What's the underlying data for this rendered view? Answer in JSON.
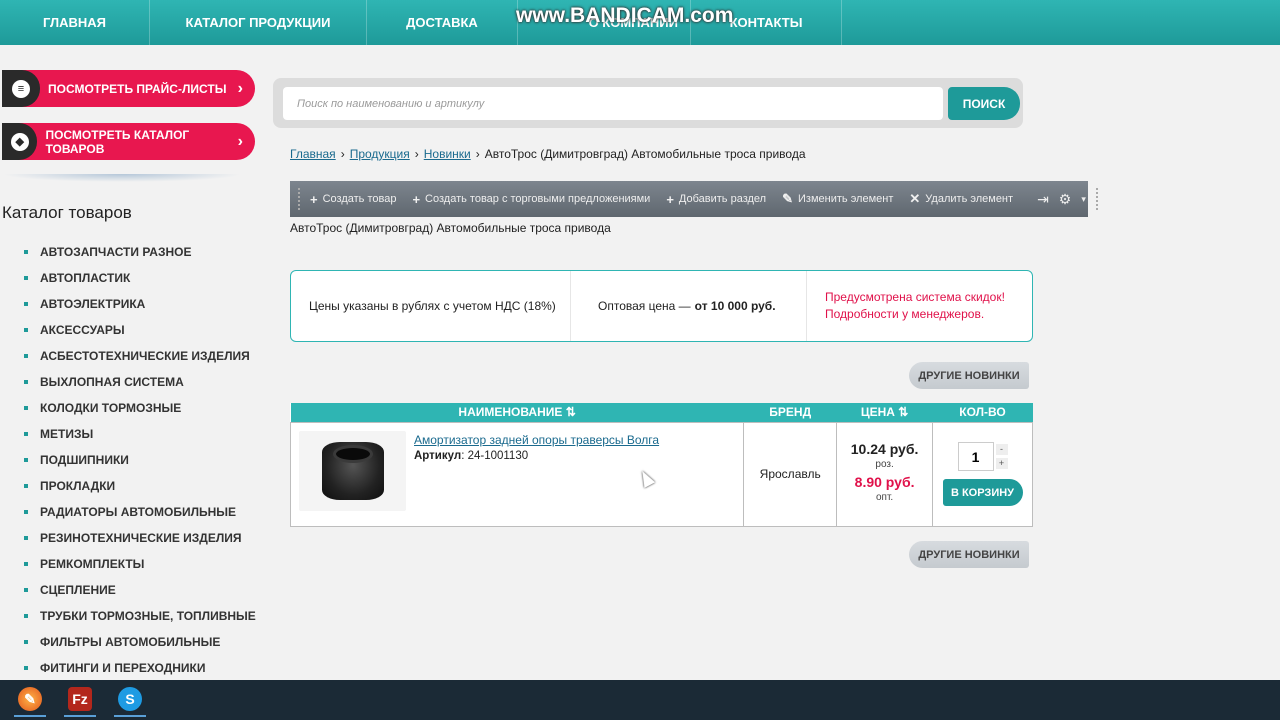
{
  "nav": {
    "items": [
      "ГЛАВНАЯ",
      "КАТАЛОГ ПРОДУКЦИИ",
      "ДОСТАВКА",
      "О КОМПАНИИ",
      "КОНТАКТЫ"
    ]
  },
  "watermark": "www.BANDICAM.com",
  "sidebar": {
    "price_button": "ПОСМОТРЕТЬ ПРАЙС-ЛИСТЫ",
    "catalog_button": "ПОСМОТРЕТЬ КАТАЛОГ ТОВАРОВ",
    "catalog_title": "Каталог товаров",
    "categories": [
      "АВТОЗАПЧАСТИ РАЗНОЕ",
      "АВТОПЛАСТИК",
      "АВТОЭЛЕКТРИКА",
      "АКСЕССУАРЫ",
      "АСБЕСТОТЕХНИЧЕСКИЕ ИЗДЕЛИЯ",
      "ВЫХЛОПНАЯ СИСТЕМА",
      "КОЛОДКИ ТОРМОЗНЫЕ",
      "МЕТИЗЫ",
      "ПОДШИПНИКИ",
      "ПРОКЛАДКИ",
      "РАДИАТОРЫ АВТОМОБИЛЬНЫЕ",
      "РЕЗИНОТЕХНИЧЕСКИЕ ИЗДЕЛИЯ",
      "РЕМКОМПЛЕКТЫ",
      "СЦЕПЛЕНИЕ",
      "ТРУБКИ ТОРМОЗНЫЕ, ТОПЛИВНЫЕ",
      "ФИЛЬТРЫ АВТОМОБИЛЬНЫЕ",
      "ФИТИНГИ И ПЕРЕХОДНИКИ"
    ]
  },
  "search": {
    "placeholder": "Поиск по наименованию и артикулу",
    "button": "ПОИСК"
  },
  "breadcrumb": {
    "home": "Главная",
    "products": "Продукция",
    "news": "Новинки",
    "current": "АвтоТрос (Димитровград) Автомобильные троса привода",
    "separator": "›"
  },
  "admin": {
    "create_item": "Создать товар",
    "create_item_offers": "Создать товар с торговыми предложениями",
    "add_section": "Добавить раздел",
    "edit_element": "Изменить элемент",
    "delete_element": "Удалить элемент"
  },
  "page_heading": "АвтоТрос (Димитровград) Автомобильные троса привода",
  "info": {
    "vat_note": "Цены указаны в рублях с учетом НДС (18%)",
    "wholesale_label": "Оптовая цена —",
    "wholesale_value": "от 10 000 руб.",
    "discount_line1": "Предусмотрена система скидок!",
    "discount_line2": "Подробности у менеджеров."
  },
  "other_news_button": "ДРУГИЕ НОВИНКИ",
  "table": {
    "headers": {
      "name": "НАИМЕНОВАНИЕ",
      "brand": "БРЕНД",
      "price": "ЦЕНА",
      "qty": "КОЛ-ВО"
    },
    "sort_icon": "⇅",
    "rows": [
      {
        "name": "Амортизатор задней опоры траверсы Волга",
        "article_label": "Артикул",
        "article": ": 24-1001130",
        "brand": "Ярославль",
        "retail_price": "10.24 руб.",
        "retail_label": "роз.",
        "wholesale_price": "8.90 руб.",
        "wholesale_label": "опт.",
        "qty": "1",
        "cart_button": "В КОРЗИНУ"
      }
    ]
  },
  "taskbar": {
    "apps": [
      "firefox-icon",
      "filezilla-icon",
      "skype-icon"
    ]
  }
}
